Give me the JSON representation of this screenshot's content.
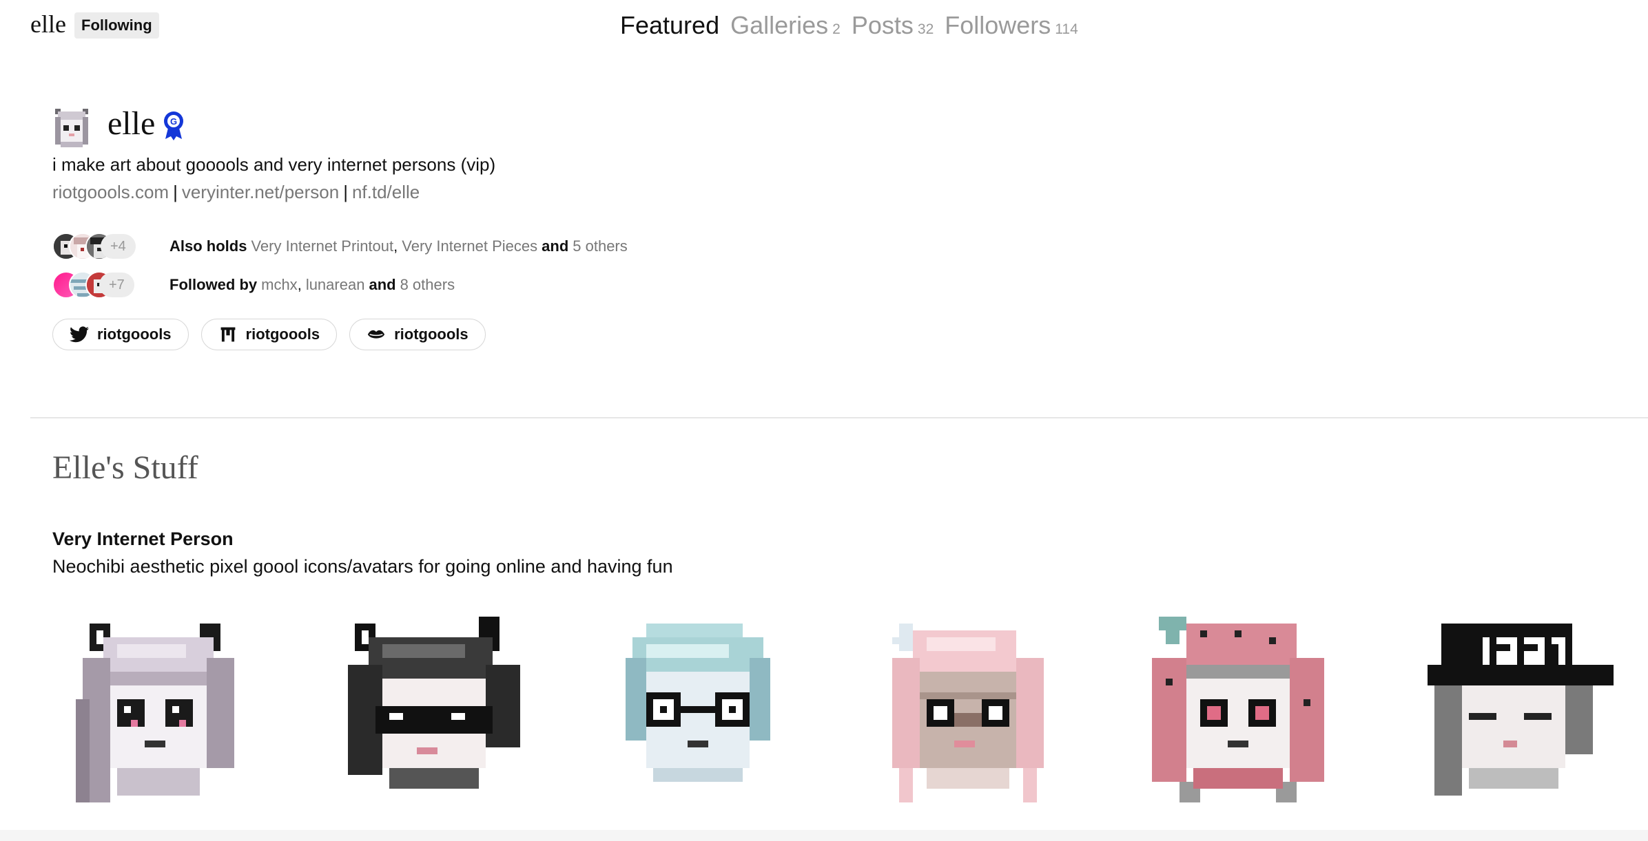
{
  "header": {
    "brand": "elle",
    "following_label": "Following",
    "nav": [
      {
        "label": "Featured",
        "count": ""
      },
      {
        "label": "Galleries",
        "count": "2"
      },
      {
        "label": "Posts",
        "count": "32"
      },
      {
        "label": "Followers",
        "count": "114"
      }
    ]
  },
  "profile": {
    "name": "elle",
    "badge_icon": "ribbon-badge-icon",
    "bio": "i make art about gooools and very internet persons (vip)",
    "links": [
      "riotgoools.com",
      "veryinter.net/person",
      "nf.td/elle"
    ],
    "link_separator": "|",
    "also_holds": {
      "more_count": "+4",
      "lead": "Also holds",
      "items": [
        "Very Internet Printout",
        "Very Internet Pieces"
      ],
      "comma": ",",
      "and": "and",
      "others": "5 others"
    },
    "followed_by": {
      "more_count": "+7",
      "lead": "Followed by",
      "items": [
        "mchx",
        "lunarean"
      ],
      "comma": ",",
      "and": "and",
      "others": "8 others"
    },
    "handles": [
      {
        "icon": "twitter-icon",
        "label": "riotgoools"
      },
      {
        "icon": "gate-icon",
        "label": "riotgoools"
      },
      {
        "icon": "lips-icon",
        "label": "riotgoools"
      }
    ]
  },
  "collection": {
    "section_title": "Elle's Stuff",
    "title": "Very Internet Person",
    "description": "Neochibi aesthetic pixel goool icons/avatars for going online and having fun",
    "items": [
      {
        "icon": "pixel-avatar-lavender-cat-icon"
      },
      {
        "icon": "pixel-avatar-black-cat-sunglasses-icon"
      },
      {
        "icon": "pixel-avatar-mint-round-glasses-icon"
      },
      {
        "icon": "pixel-avatar-pink-star-icon"
      },
      {
        "icon": "pixel-avatar-strawberry-icon"
      },
      {
        "icon": "pixel-avatar-1337-cap-icon"
      }
    ]
  },
  "colors": {
    "accent_badge": "#1437d8",
    "muted_text": "#777777",
    "pill_bg": "#ececec"
  }
}
